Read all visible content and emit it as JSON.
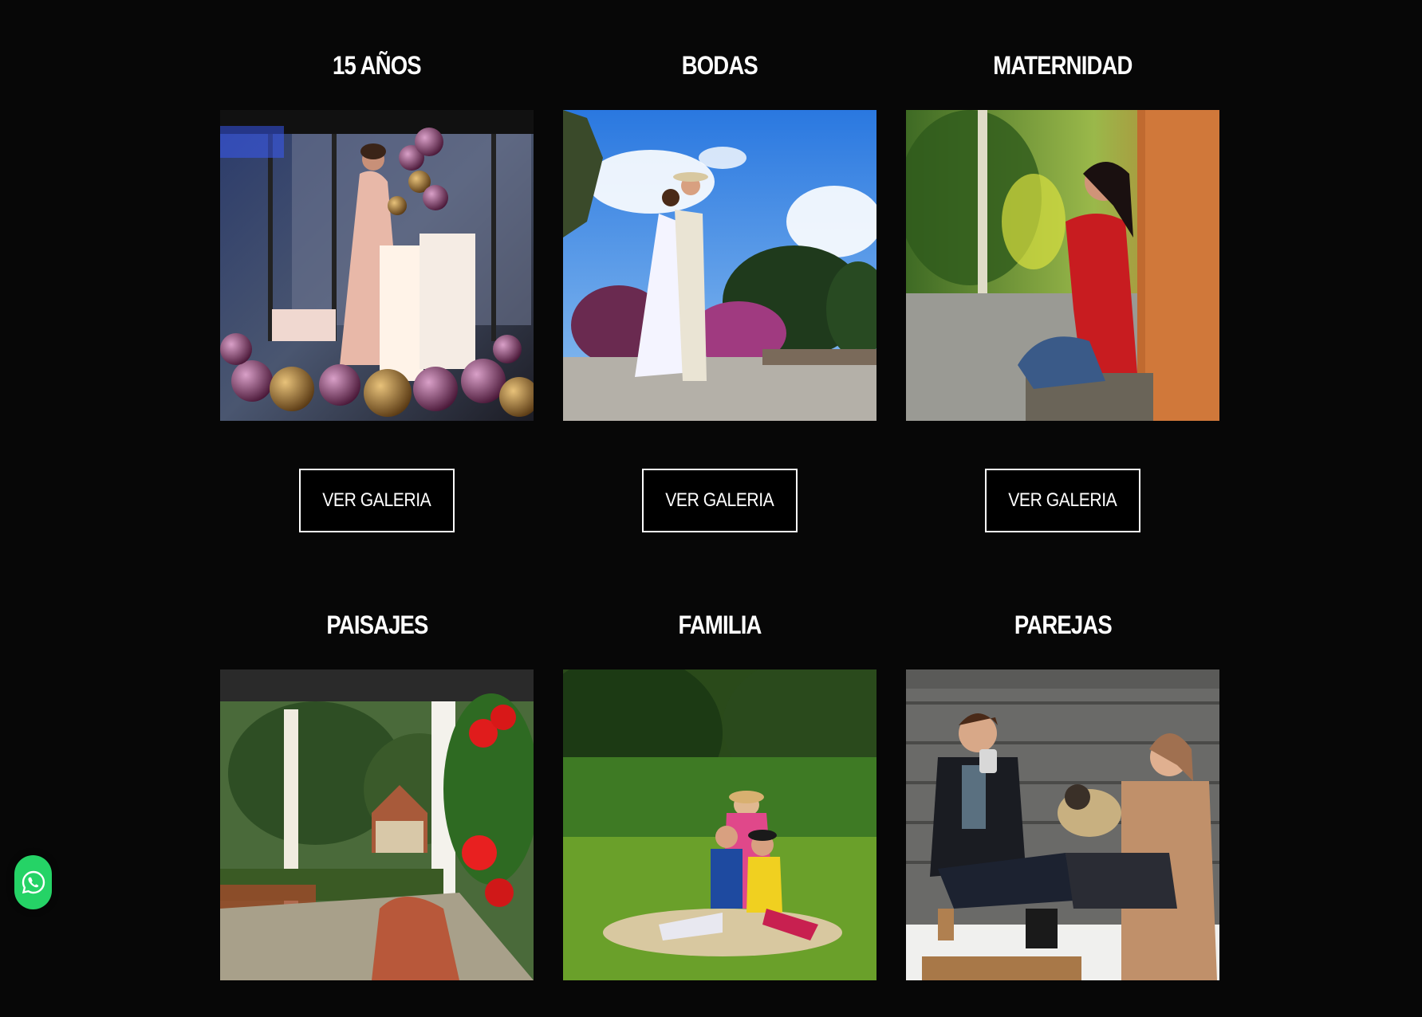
{
  "galleries": [
    {
      "title": "15 AÑOS",
      "button_label": "VER GALERIA",
      "photo": "quinceanera-photo"
    },
    {
      "title": "BODAS",
      "button_label": "VER GALERIA",
      "photo": "wedding-photo"
    },
    {
      "title": "MATERNIDAD",
      "button_label": "VER GALERIA",
      "photo": "maternity-photo"
    },
    {
      "title": "PAISAJES",
      "photo": "landscape-photo"
    },
    {
      "title": "FAMILIA",
      "photo": "family-photo"
    },
    {
      "title": "PAREJAS",
      "photo": "couple-photo"
    }
  ],
  "floating": {
    "icon": "whatsapp-icon",
    "color": "#25d366"
  },
  "colors": {
    "background": "#070707",
    "text": "#ffffff",
    "button_border": "#ffffff"
  }
}
